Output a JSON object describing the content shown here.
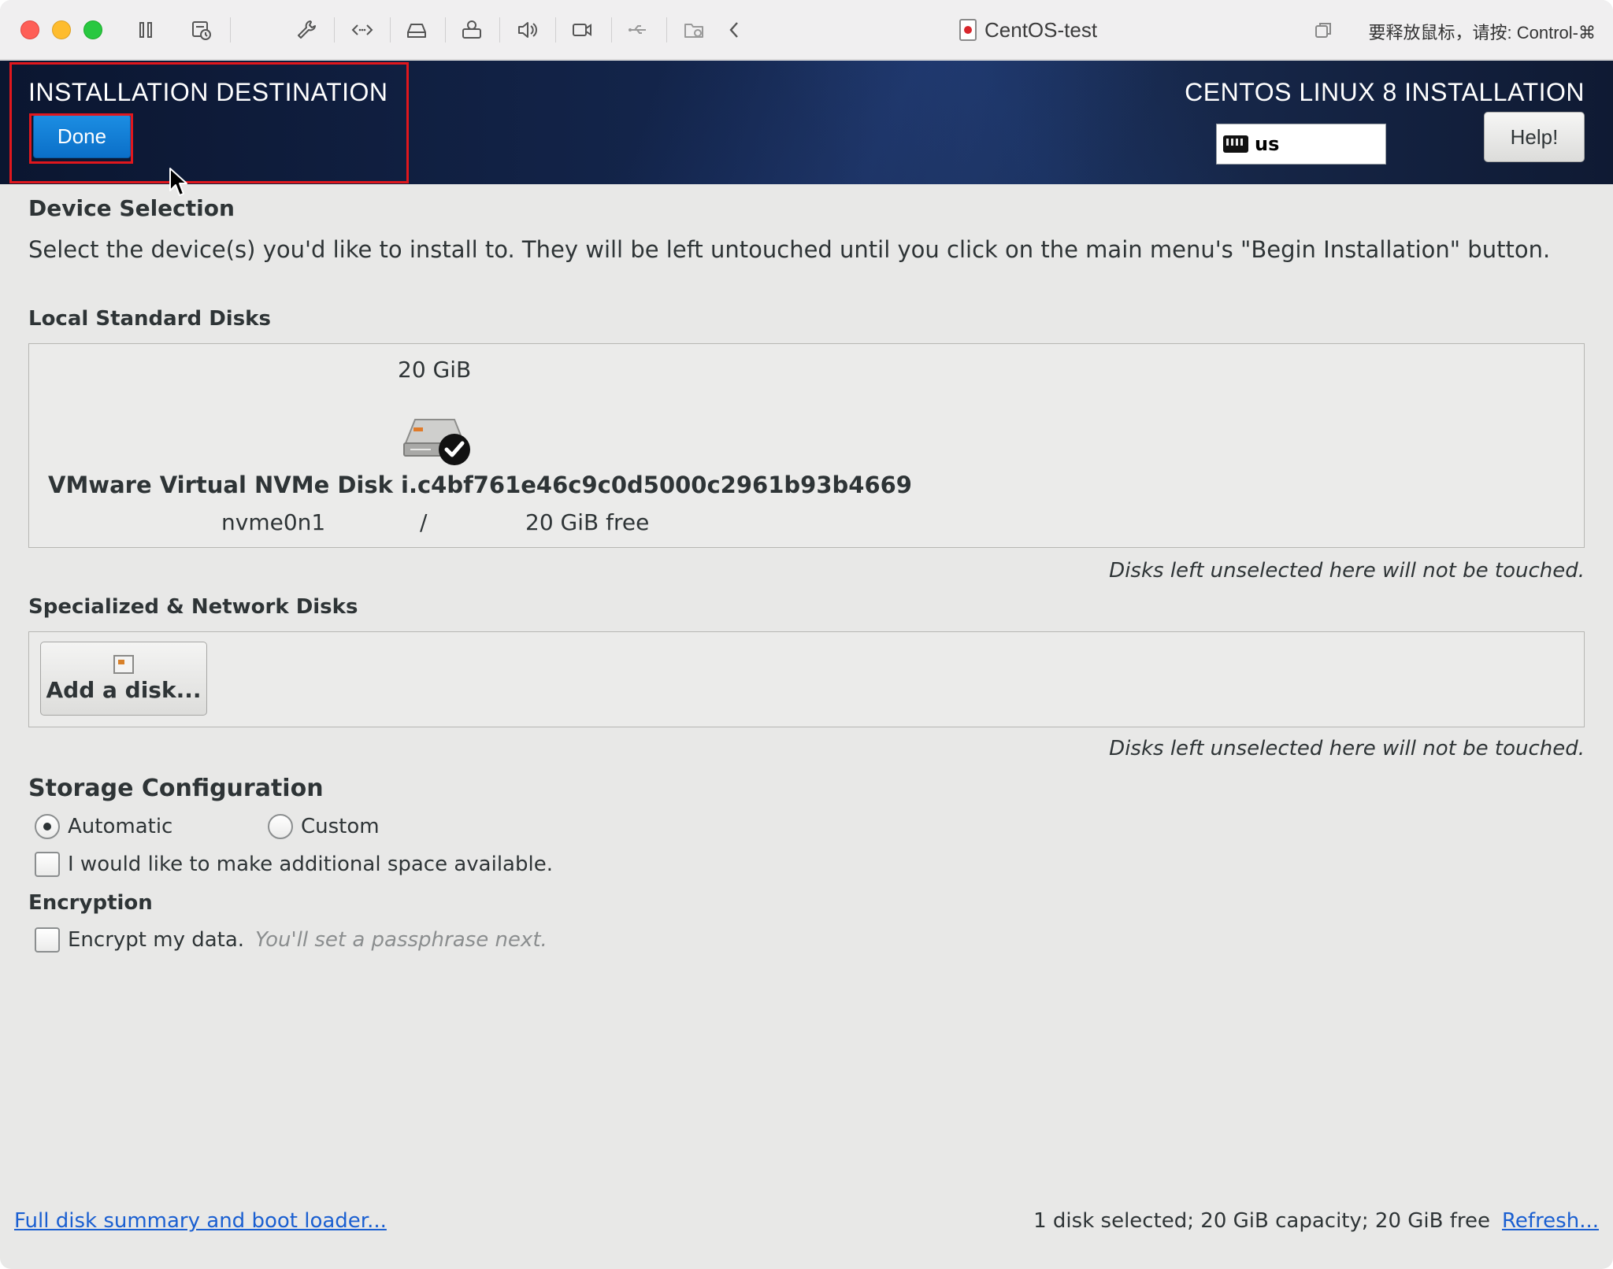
{
  "window": {
    "title": "CentOS-test",
    "release_hint": "要释放鼠标，请按: Control-⌘"
  },
  "header": {
    "spoke_title": "INSTALLATION DESTINATION",
    "done_label": "Done",
    "product_title": "CENTOS LINUX 8 INSTALLATION",
    "keyboard_layout": "us",
    "help_label": "Help!"
  },
  "device_selection": {
    "heading": "Device Selection",
    "description": "Select the device(s) you'd like to install to.  They will be left untouched until you click on the main menu's \"Begin Installation\" button."
  },
  "local_disks": {
    "heading": "Local Standard Disks",
    "disks": [
      {
        "size": "20 GiB",
        "name": "VMware Virtual NVMe Disk i.c4bf761e46c9c0d5000c2961b93b4669",
        "device": "nvme0n1",
        "mount": "/",
        "free": "20 GiB free",
        "selected": true
      }
    ],
    "note": "Disks left unselected here will not be touched."
  },
  "network_disks": {
    "heading": "Specialized & Network Disks",
    "add_label": "Add a disk...",
    "note": "Disks left unselected here will not be touched."
  },
  "storage_config": {
    "heading": "Storage Configuration",
    "automatic_label": "Automatic",
    "custom_label": "Custom",
    "selected": "Automatic",
    "reclaim_label": "I would like to make additional space available.",
    "reclaim_checked": false
  },
  "encryption": {
    "heading": "Encryption",
    "encrypt_label": "Encrypt my data.",
    "encrypt_hint": "You'll set a passphrase next.",
    "encrypt_checked": false
  },
  "footer": {
    "summary_link": "Full disk summary and boot loader...",
    "status": "1 disk selected; 20 GiB capacity; 20 GiB free",
    "refresh_link": "Refresh..."
  },
  "colors": {
    "accent": "#0b6fc8",
    "highlight": "#e0171d",
    "link": "#1a5fd1"
  }
}
